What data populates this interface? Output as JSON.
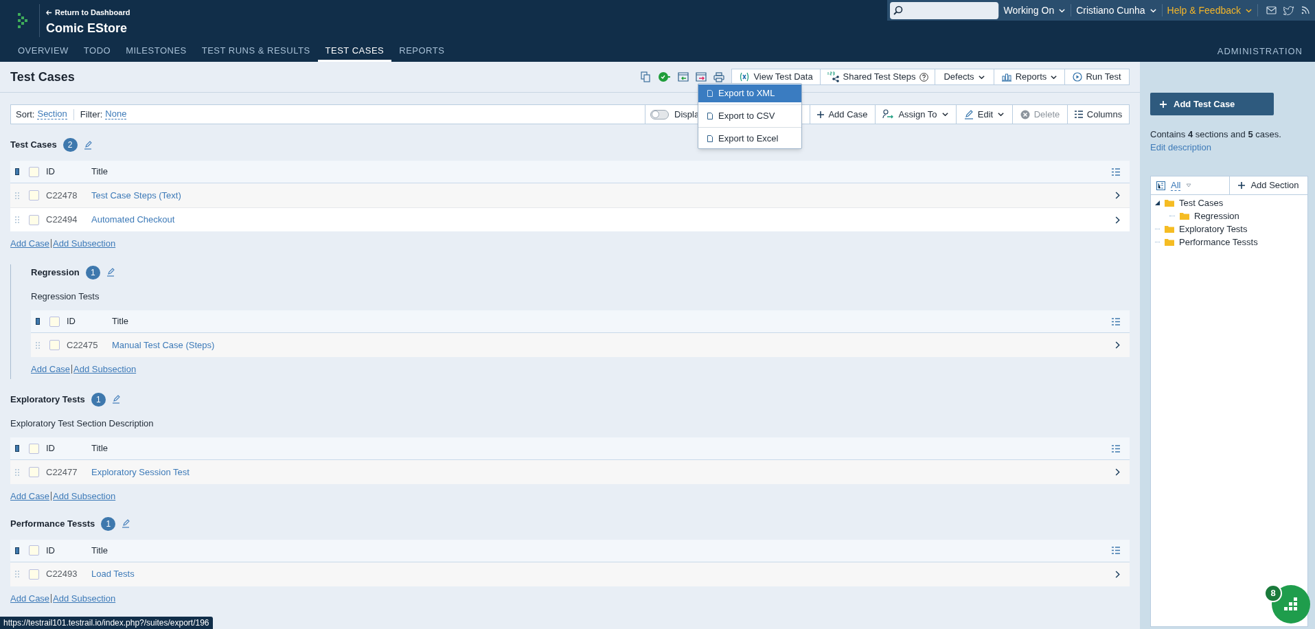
{
  "header": {
    "back_link": "Return to Dashboard",
    "project": "Comic EStore",
    "menus": [
      {
        "label": "Working On",
        "kind": "plain"
      },
      {
        "label": "Cristiano Cunha",
        "kind": "plain"
      },
      {
        "label": "Help & Feedback",
        "kind": "highlight"
      }
    ]
  },
  "nav": {
    "tabs": [
      {
        "label": "OVERVIEW",
        "selected": false
      },
      {
        "label": "TODO",
        "selected": false
      },
      {
        "label": "MILESTONES",
        "selected": false
      },
      {
        "label": "TEST RUNS & RESULTS",
        "selected": false
      },
      {
        "label": "TEST CASES",
        "selected": true
      },
      {
        "label": "REPORTS",
        "selected": false
      }
    ],
    "admin": "ADMINISTRATION"
  },
  "page": {
    "title": "Test Cases",
    "toolbar_buttons": [
      {
        "label": "View Test Data",
        "kind": "data"
      },
      {
        "label": "Shared Test Steps",
        "kind": "steps"
      },
      {
        "label": "Defects",
        "kind": "dropdown"
      },
      {
        "label": "Reports",
        "kind": "reports"
      },
      {
        "label": "Run Test",
        "kind": "run"
      }
    ],
    "export_menu": [
      {
        "label": "Export to XML",
        "selected": true
      },
      {
        "label": "Export to CSV",
        "selected": false
      },
      {
        "label": "Export to Excel",
        "selected": false
      }
    ]
  },
  "filter_bar": {
    "sort_label": "Sort:",
    "sort_value": "Section",
    "filter_label": "Filter:",
    "filter_value": "None",
    "display_toggle": {
      "label": "Displa",
      "on": false
    },
    "buttons": [
      {
        "label": "Add Case",
        "kind": "add",
        "disabled": false
      },
      {
        "label": "Assign To",
        "kind": "assign",
        "disabled": false
      },
      {
        "label": "Edit",
        "kind": "edit",
        "disabled": false
      },
      {
        "label": "Delete",
        "kind": "delete",
        "disabled": true
      },
      {
        "label": "Columns",
        "kind": "columns",
        "disabled": false
      }
    ]
  },
  "sections": [
    {
      "title": "Test Cases",
      "count": "2",
      "columns": [
        "ID",
        "Title"
      ],
      "all_checked": false,
      "rows": [
        {
          "id": "C22478",
          "title": "Test Case Steps (Text)",
          "checked": false
        },
        {
          "id": "C22494",
          "title": "Automated Checkout",
          "checked": false
        }
      ],
      "links": [
        "Add Case",
        "Add Subsection"
      ],
      "children": [
        {
          "title": "Regression",
          "count": "1",
          "description": "Regression Tests",
          "columns": [
            "ID",
            "Title"
          ],
          "all_checked": false,
          "rows": [
            {
              "id": "C22475",
              "title": "Manual Test Case (Steps)",
              "checked": false
            }
          ],
          "links": [
            "Add Case",
            "Add Subsection"
          ]
        }
      ]
    },
    {
      "title": "Exploratory Tests",
      "count": "1",
      "description": "Exploratory Test Section Description",
      "columns": [
        "ID",
        "Title"
      ],
      "all_checked": false,
      "rows": [
        {
          "id": "C22477",
          "title": "Exploratory Session Test",
          "checked": false
        }
      ],
      "links": [
        "Add Case",
        "Add Subsection"
      ]
    },
    {
      "title": "Performance Tessts",
      "count": "1",
      "columns": [
        "ID",
        "Title"
      ],
      "all_checked": false,
      "rows": [
        {
          "id": "C22493",
          "title": "Load Tests",
          "checked": false
        }
      ],
      "links": [
        "Add Case",
        "Add Subsection"
      ]
    }
  ],
  "sidebar": {
    "add_button": "Add Test Case",
    "summary": "Contains **4** sections and **5** cases.",
    "edit_link": "Edit description",
    "tree_filter": "All",
    "add_section": "Add Section",
    "tree": [
      {
        "label": "Test Cases",
        "expanded": true,
        "children": [
          {
            "label": "Regression"
          }
        ]
      },
      {
        "label": "Exploratory Tests",
        "expanded": false
      },
      {
        "label": "Performance Tessts",
        "expanded": false
      }
    ]
  },
  "status_url": "https://testrail101.testrail.io/index.php?/suites/export/196",
  "help_widget": {
    "badge": "8"
  }
}
